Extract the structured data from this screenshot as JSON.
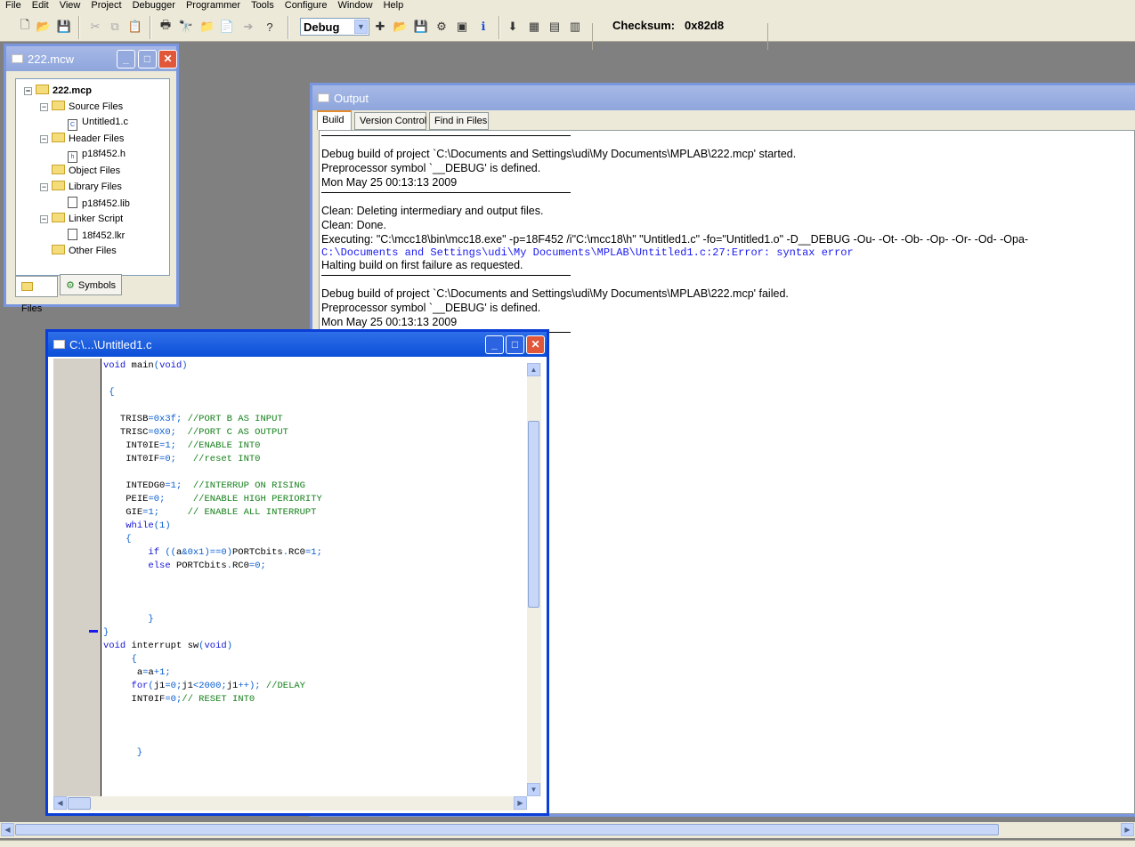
{
  "menu": [
    "File",
    "Edit",
    "View",
    "Project",
    "Debugger",
    "Programmer",
    "Tools",
    "Configure",
    "Window",
    "Help"
  ],
  "toolbar": {
    "config": "Debug",
    "checksum_label": "Checksum:",
    "checksum_value": "0x82d8"
  },
  "project_window": {
    "title": "222.mcw",
    "root": "222.mcp",
    "tree": [
      {
        "label": "Source Files",
        "type": "folder"
      },
      {
        "label": "Untitled1.c",
        "type": "file",
        "glyph": "C"
      },
      {
        "label": "Header Files",
        "type": "folder"
      },
      {
        "label": "p18f452.h",
        "type": "file",
        "glyph": "h"
      },
      {
        "label": "Object Files",
        "type": "folder"
      },
      {
        "label": "Library Files",
        "type": "folder"
      },
      {
        "label": "p18f452.lib",
        "type": "file",
        "glyph": ""
      },
      {
        "label": "Linker Script",
        "type": "folder"
      },
      {
        "label": "18f452.lkr",
        "type": "file",
        "glyph": ""
      },
      {
        "label": "Other Files",
        "type": "folder"
      }
    ],
    "tab_files": "Files",
    "tab_symbols": "Symbols"
  },
  "output_window": {
    "title": "Output",
    "tabs": [
      "Build",
      "Version Control",
      "Find in Files"
    ],
    "lines": [
      "Debug build of project `C:\\Documents and Settings\\udi\\My Documents\\MPLAB\\222.mcp' started.",
      "Preprocessor symbol `__DEBUG' is defined.",
      "Mon May 25 00:13:13 2009",
      "Clean: Deleting intermediary and output files.",
      "Clean: Done.",
      "Executing: \"C:\\mcc18\\bin\\mcc18.exe\" -p=18F452 /i\"C:\\mcc18\\h\" \"Untitled1.c\" -fo=\"Untitled1.o\" -D__DEBUG -Ou- -Ot- -Ob- -Op- -Or- -Od- -Opa-",
      "C:\\Documents and Settings\\udi\\My Documents\\MPLAB\\Untitled1.c:27:Error: syntax error",
      "Halting build on first failure as requested.",
      "Debug build of project `C:\\Documents and Settings\\udi\\My Documents\\MPLAB\\222.mcp' failed.",
      "Preprocessor symbol `__DEBUG' is defined.",
      "Mon May 25 00:13:13 2009"
    ]
  },
  "editor": {
    "title": "C:\\...\\Untitled1.c",
    "code": [
      "void main(void)",
      "",
      " {",
      "",
      "   TRISB=0x3f; //PORT B AS INPUT",
      "   TRISC=0X0;  //PORT C AS OUTPUT",
      "    INT0IE=1;  //ENABLE INT0",
      "    INT0IF=0;   //reset INT0",
      "",
      "    INTEDG0=1;  //INTERRUP ON RISING",
      "    PEIE=0;     //ENABLE HIGH PERIORITY",
      "    GIE=1;     // ENABLE ALL INTERRUPT",
      "    while(1)",
      "    {",
      "        if ((a&0x1)==0)PORTCbits.RC0=1;",
      "        else PORTCbits.RC0=0;",
      "",
      "",
      "",
      "        }",
      "}",
      "void interrupt sw(void)",
      "     {",
      "      a=a+1;",
      "     for(j1=0;j1<2000;j1++); //DELAY",
      "     INT0IF=0;// RESET INT0",
      "",
      "",
      "",
      "      }"
    ]
  }
}
